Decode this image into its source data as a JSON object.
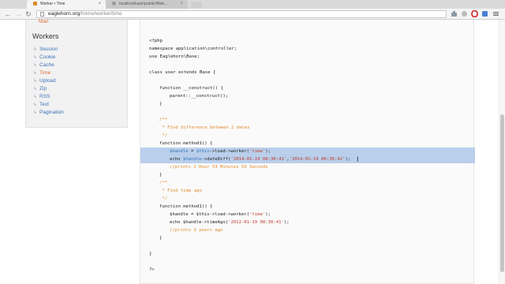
{
  "browser": {
    "tabs": [
      {
        "title": "Worker • Time",
        "close": "×"
      },
      {
        "title": "localhost/user/public/Web...",
        "close": "×"
      }
    ],
    "url_domain": "eaglehorn.org",
    "url_path": "/home/worker/time",
    "nav": {
      "back": "←",
      "forward": "→",
      "reload": "↻"
    }
  },
  "sidebar": {
    "top_item": "Mail",
    "heading": "Workers",
    "items": [
      "Session",
      "Cookie",
      "Cache",
      "Time",
      "Upload",
      "Zip",
      "RSS",
      "Text",
      "Pagination"
    ],
    "active_item": "Time"
  },
  "code": {
    "l1": "<?php",
    "l2": "namespace application\\controller;",
    "l3": "use Eaglehorn\\Base;",
    "l4": "class user extends Base {",
    "l5": "function __construct() {",
    "l6": "parent::__construct();",
    "l7": "}",
    "l8": "/**",
    "l9": " * Find difference between 2 dates",
    "l10": " */",
    "l11": "function method1() {",
    "l12a": "$handle",
    "l12b": " = ",
    "l12c": "$this",
    "l12d": "->load->worker(",
    "l12e": "'time'",
    "l12f": ");",
    "l13a": "echo ",
    "l13b": "$handle",
    "l13c": "->dateDiff(",
    "l13d": "'2014-01-19 08:30:41'",
    "l13e": ",",
    "l13f": "'2014-01-19 06:36:42'",
    "l13g": ");",
    "l14": "//prints 1 Hour 53 Minutes 59 Seconds",
    "l15": "}",
    "l16": "/**",
    "l17": " * Find time ago",
    "l18": " */",
    "l19": "function method1() {",
    "l20a": "$handle = $this->load->worker(",
    "l20b": "'time'",
    "l20c": ");",
    "l21a": "echo $handle->timeAgo(",
    "l21b": "'2012-01-19 08:30:41'",
    "l21c": ");",
    "l22": "//prints 3 years ago",
    "l23": "}",
    "l24": "}",
    "l25": "?>"
  },
  "colors": {
    "link": "#3b72b8",
    "active_link": "#e0703a",
    "comment": "#e08a2c",
    "string": "#c0392b",
    "selection": "#b9cfeb"
  },
  "icons": [
    "back-arrow-icon",
    "forward-arrow-icon",
    "reload-icon",
    "page-icon",
    "extension-icon",
    "opera-icon",
    "menu-icon",
    "text-cursor-icon"
  ]
}
